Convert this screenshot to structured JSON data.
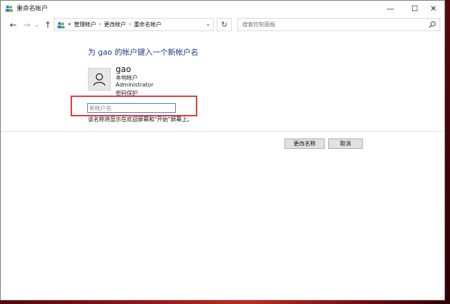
{
  "window": {
    "title": "重命名帐户",
    "controls": {
      "minimize": "—",
      "maximize": "☐",
      "close": "✕"
    }
  },
  "nav": {
    "back": "←",
    "forward": "→",
    "recent": "⌄",
    "up": "↑",
    "breadcrumb_prefix": "«",
    "breadcrumbs": [
      "管理帐户",
      "更改帐户",
      "重命名帐户"
    ],
    "separator": "›",
    "dropdown": "⌄",
    "refresh": "↻",
    "search_placeholder": "搜索控制面板"
  },
  "content": {
    "heading": "为 gao 的帐户键入一个新帐户名",
    "user": {
      "name": "gao",
      "type": "本地帐户",
      "role": "Administrator",
      "protection": "密码保护"
    },
    "new_name_placeholder": "新帐户名",
    "new_name_value": "",
    "hint": "该名称将显示在欢迎屏幕和\"开始\"屏幕上。"
  },
  "buttons": {
    "rename": "更改名称",
    "cancel": "取消"
  },
  "colors": {
    "heading": "#1e3a8a",
    "highlight": "#e53935",
    "input_focus": "#3c7fd0"
  }
}
